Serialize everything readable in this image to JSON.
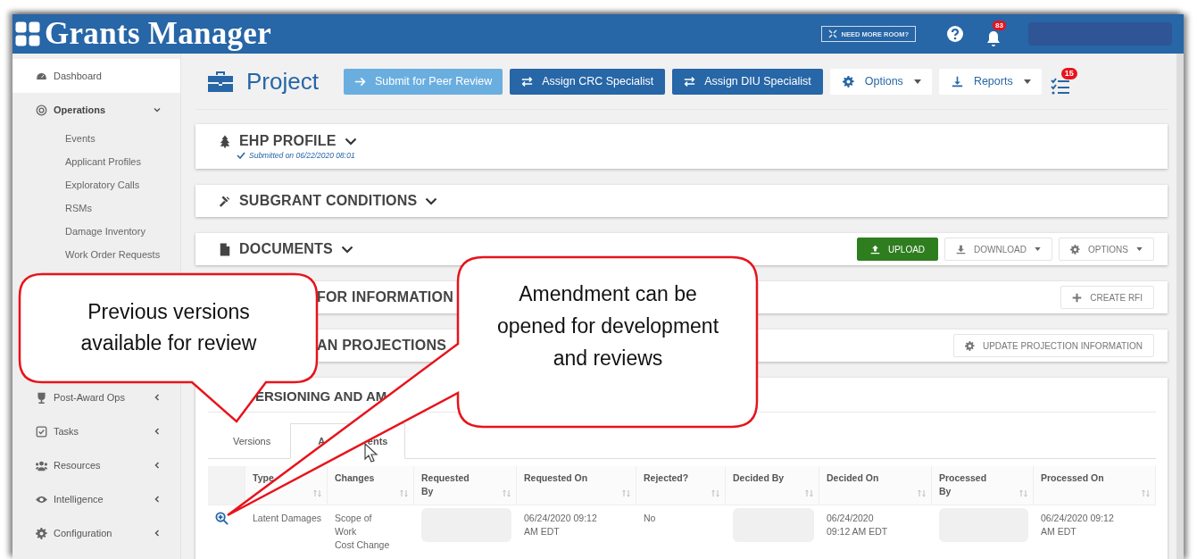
{
  "header": {
    "app_name": "Grants Manager",
    "room_button": "NEED MORE ROOM?",
    "notifications_badge": "83"
  },
  "sidebar": {
    "items": [
      {
        "label": "Dashboard",
        "kind": "link",
        "selected": true
      },
      {
        "label": "Operations",
        "kind": "group",
        "selected": false,
        "expanded": true,
        "children": [
          {
            "label": "Events"
          },
          {
            "label": "Applicant Profiles"
          },
          {
            "label": "Exploratory Calls"
          },
          {
            "label": "RSMs"
          },
          {
            "label": "Damage Inventory"
          },
          {
            "label": "Work Order Requests"
          }
        ]
      },
      {
        "label": "Post-Award Ops",
        "kind": "group",
        "selected": false,
        "expanded": false
      },
      {
        "label": "Tasks",
        "kind": "group",
        "selected": false,
        "expanded": false
      },
      {
        "label": "Resources",
        "kind": "group",
        "selected": false,
        "expanded": false
      },
      {
        "label": "Intelligence",
        "kind": "group",
        "selected": false,
        "expanded": false
      },
      {
        "label": "Configuration",
        "kind": "group",
        "selected": false,
        "expanded": false
      }
    ]
  },
  "toolbar": {
    "title": "Project",
    "buttons": [
      {
        "label": "Submit for Peer Review",
        "kind": "light"
      },
      {
        "label": "Assign CRC Specialist",
        "kind": "primary"
      },
      {
        "label": "Assign DIU Specialist",
        "kind": "primary"
      },
      {
        "label": "Options",
        "kind": "dropdown"
      },
      {
        "label": "Reports",
        "kind": "dropdown"
      }
    ],
    "tasks_badge": "15"
  },
  "sections": [
    {
      "title": "EHP PROFILE",
      "subtitle": "Submitted on 06/22/2020 08:01"
    },
    {
      "title": "SUBGRANT CONDITIONS"
    },
    {
      "title": "DOCUMENTS",
      "buttons": [
        {
          "label": "UPLOAD",
          "kind": "success"
        },
        {
          "label": "DOWNLOAD",
          "kind": "dropdown"
        },
        {
          "label": "OPTIONS",
          "kind": "dropdown"
        }
      ]
    },
    {
      "title": "FOR INFORMATION",
      "buttons": [
        {
          "label": "CREATE RFI",
          "kind": "plain"
        }
      ]
    },
    {
      "title": "AN PROJECTIONS",
      "buttons": [
        {
          "label": "UPDATE PROJECTION INFORMATION",
          "kind": "plain"
        }
      ]
    }
  ],
  "versioning": {
    "title": "ERSIONING AND AM",
    "tabs": [
      {
        "label": "Versions",
        "selected": false
      },
      {
        "label": "A ents",
        "selected": true
      }
    ],
    "table": {
      "columns": [
        "Type",
        "Changes",
        "Requested By",
        "Requested On",
        "Rejected?",
        "Decided By",
        "Decided On",
        "Processed By",
        "Processed On"
      ],
      "rows": [
        {
          "type": "Latent Damages",
          "changes": [
            "Scope of Work",
            "Cost Change"
          ],
          "requested_on": "06/24/2020 09:12 AM EDT",
          "rejected": "No",
          "decided_on": "06/24/2020 09:12 AM EDT",
          "processed_on": "06/24/2020 09:12 AM EDT"
        }
      ]
    }
  },
  "callouts": [
    {
      "text": "Previous versions available for review"
    },
    {
      "text": "Amendment can be opened for development and reviews"
    }
  ]
}
